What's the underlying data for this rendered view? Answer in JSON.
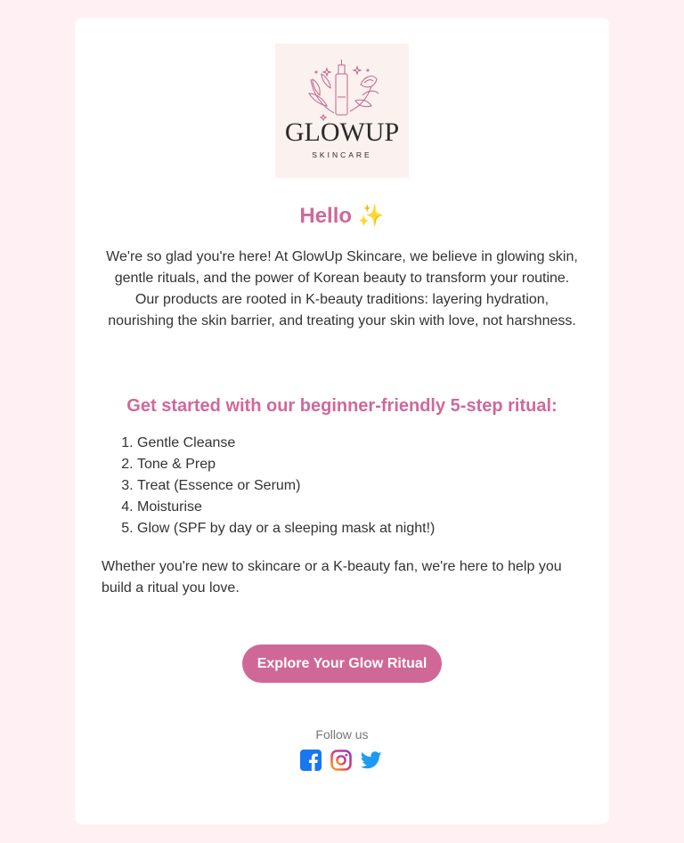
{
  "logo": {
    "brand": "GLOWUP",
    "tagline": "SKINCARE",
    "colors": {
      "background": "#fbf1ee",
      "line": "#c0628f",
      "text": "#2b2b2b"
    }
  },
  "greeting": {
    "text": "Hello",
    "emoji": "✨"
  },
  "intro": "We're so glad you're here! At GlowUp Skincare, we believe in glowing skin, gentle rituals, and the power of Korean beauty to transform your routine. Our products are rooted in K-beauty traditions: layering hydration, nourishing the skin barrier, and treating your skin with love, not harshness.",
  "ritual": {
    "title": "Get started with our beginner-friendly 5-step ritual:",
    "steps": [
      "Gentle Cleanse",
      "Tone & Prep",
      "Treat (Essence or Serum)",
      "Moisturise",
      "Glow (SPF by day or a sleeping mask at night!)"
    ]
  },
  "outro": "Whether you're new to skincare or a K-beauty fan, we're here to help you build a ritual you love.",
  "cta": {
    "label": "Explore Your Glow Ritual"
  },
  "social": {
    "label": "Follow us",
    "icons": [
      "facebook-icon",
      "instagram-icon",
      "twitter-icon"
    ]
  },
  "colors": {
    "page_bg": "#fff0f3",
    "accent": "#d0689a",
    "button": "#cf6897",
    "facebook": "#1877f2",
    "twitter": "#1d9bf0"
  }
}
